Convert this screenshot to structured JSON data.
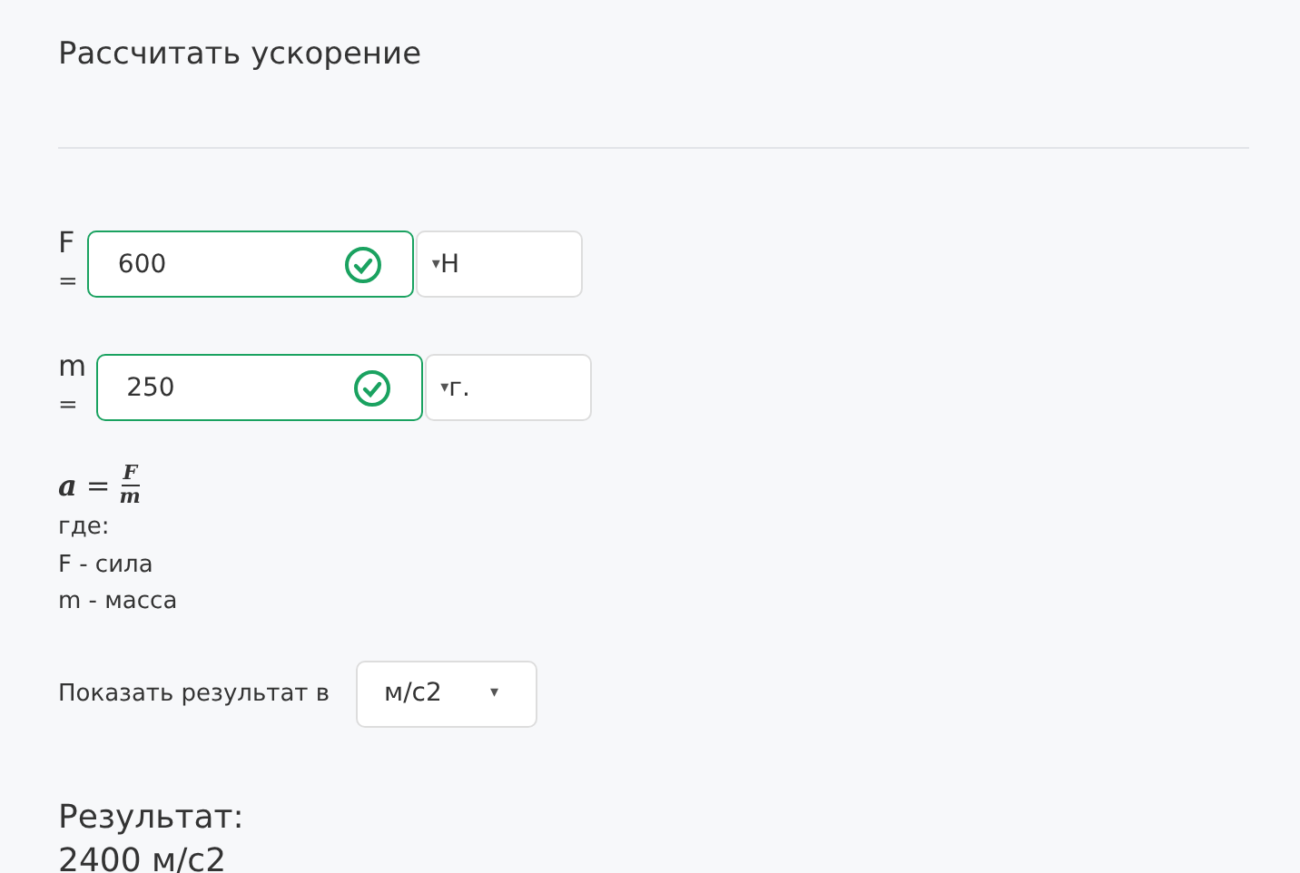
{
  "title": "Рассчитать ускорение",
  "inputs": [
    {
      "name": "F",
      "eq": "=",
      "value": "600",
      "valid": true,
      "caret": "▾",
      "unit": "Н"
    },
    {
      "name": "m",
      "eq": "=",
      "value": "250",
      "valid": true,
      "caret": "▾",
      "unit": "г."
    }
  ],
  "formula": {
    "lhs": "a",
    "eq": "=",
    "numerator": "F",
    "denominator": "m"
  },
  "legend": [
    "где:",
    "F - сила",
    "m - масса"
  ],
  "show_in": {
    "label": "Показать результат в",
    "value": "м/с2",
    "caret": "▾"
  },
  "result": {
    "label": "Результат:",
    "value": "2400 м/с2"
  }
}
